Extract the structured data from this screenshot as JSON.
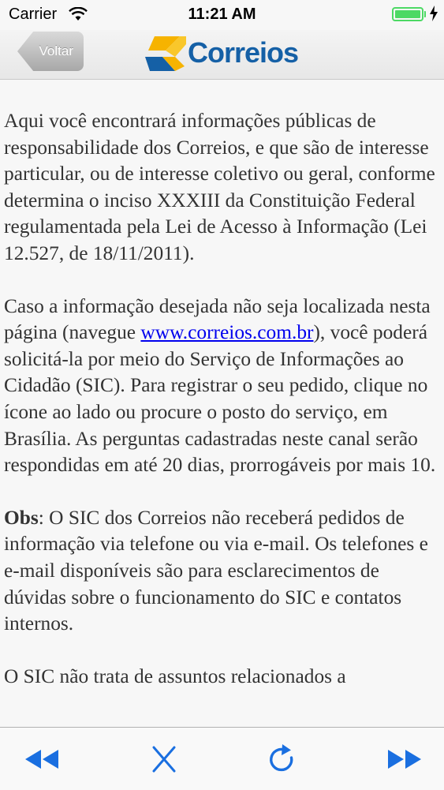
{
  "status_bar": {
    "carrier": "Carrier",
    "time": "11:21 AM",
    "battery_level": 1.0
  },
  "nav_bar": {
    "back_label": "Voltar",
    "logo_text": "Correios",
    "logo_colors": {
      "blue": "#1560a6",
      "yellow": "#f6b300"
    }
  },
  "content": {
    "p1": "Aqui você encontrará informações públicas de responsabilidade dos Correios, e que são de interesse particular, ou de interesse coletivo ou geral, conforme determina o inciso XXXIII da Constituição Federal regulamentada pela Lei de Acesso à Informação (Lei 12.527, de 18/11/2011).",
    "p2_before": "Caso a informação desejada não seja localizada nesta página (navegue ",
    "p2_link": "www.correios.com.br",
    "p2_after": "), você poderá solicitá-la por meio do Serviço de Informações ao Cidadão (SIC). Para registrar o seu pedido, clique no ícone ao lado ou procure o posto do serviço, em Brasília. As perguntas cadastradas neste canal serão respondidas em até 20 dias, prorrogáveis por mais 10.",
    "p3_label": "Obs",
    "p3_text": ": O SIC dos Correios não receberá pedidos de informação via telefone ou via e-mail. Os telefones e e-mail disponíveis são para esclarecimentos de dúvidas sobre o funcionamento do SIC e contatos internos.",
    "p4": "O SIC não trata de assuntos relacionados a"
  },
  "toolbar": {
    "icons": [
      "rewind-icon",
      "close-icon",
      "reload-icon",
      "fast-forward-icon"
    ],
    "icon_color": "#1a6fe0"
  }
}
